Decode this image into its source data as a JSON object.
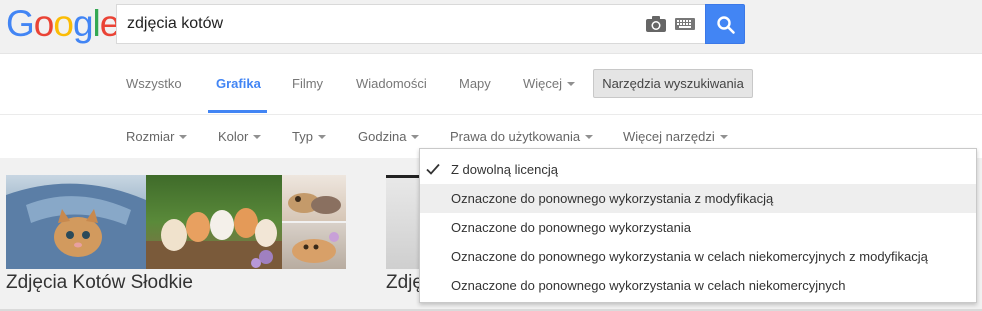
{
  "logo": {
    "letters": [
      "G",
      "o",
      "o",
      "g",
      "l",
      "e"
    ],
    "colors": [
      "#4285f4",
      "#ea4335",
      "#fbbc05",
      "#4285f4",
      "#34a853",
      "#ea4335"
    ]
  },
  "search": {
    "value": "zdjęcia kotów",
    "camera_icon": "camera-icon",
    "keyboard_icon": "keyboard-icon",
    "button_icon": "search-icon"
  },
  "tabs": [
    {
      "label": "Wszystko"
    },
    {
      "label": "Grafika",
      "active": true
    },
    {
      "label": "Filmy"
    },
    {
      "label": "Wiadomości"
    },
    {
      "label": "Mapy"
    },
    {
      "label": "Więcej"
    }
  ],
  "search_tools_label": "Narzędzia wyszukiwania",
  "tools": [
    {
      "label": "Rozmiar"
    },
    {
      "label": "Kolor"
    },
    {
      "label": "Typ"
    },
    {
      "label": "Godzina"
    },
    {
      "label": "Prawa do użytkowania"
    },
    {
      "label": "Więcej narzędzi"
    }
  ],
  "results": [
    {
      "title": "Zdjęcia Kotów Słodkie"
    },
    {
      "title": "Zdję"
    }
  ],
  "usage_rights_menu": {
    "items": [
      {
        "label": "Z dowolną licencją",
        "selected": true
      },
      {
        "label": "Oznaczone do ponownego wykorzystania z modyfikacją",
        "hover": true
      },
      {
        "label": "Oznaczone do ponownego wykorzystania"
      },
      {
        "label": "Oznaczone do ponownego wykorzystania w celach niekomercyjnych z modyfikacją"
      },
      {
        "label": "Oznaczone do ponownego wykorzystania w celach niekomercyjnych"
      }
    ]
  },
  "colors": {
    "accent": "#4285f4",
    "header_bg": "#f1f1f1"
  }
}
